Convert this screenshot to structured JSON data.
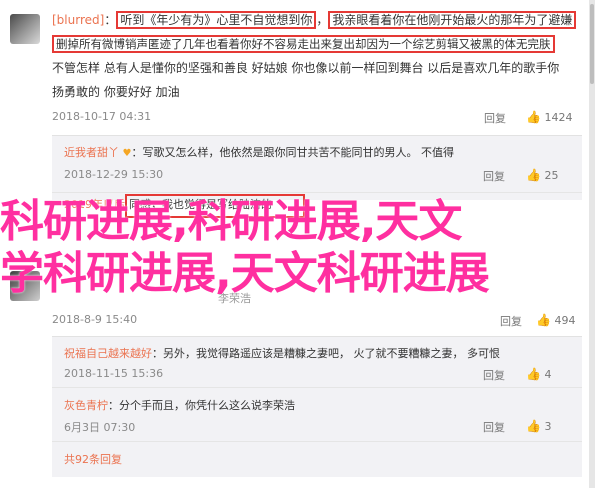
{
  "main_comment": {
    "username": "[blurred]",
    "line1_prefix": "：",
    "line1_highlight": "听到《年少有为》心里不自觉想到你",
    "line1_suffix": "，",
    "line1_highlight2": "我亲眼看着你在他刚开始最火的那年为了避嫌",
    "line2_highlight": "删掉所有微博销声匿迹了几年也看着你好不容易走出来复出却因为一个综艺剪辑又被黑的体无完肤",
    "line3": "不管怎样 总有人是懂你的坚强和善良 好姑娘 你也像以前一样回到舞台 以后是喜欢几年的歌手你",
    "line4": "扬勇敢的 你要好好 加油",
    "date": "2018-10-17 04:31",
    "reply_label": "回复",
    "like_icon": "thumbs-up-icon",
    "like_count": "1424"
  },
  "replies_top": [
    {
      "name": "近我者甜丫",
      "text": "：写歌又怎么样，他依然是跟你同甘共苦不能同甘的男人。  不值得",
      "date": "2018-12-29 15:30",
      "reply_label": "回复",
      "likes": "25"
    },
    {
      "name": "2019年以后",
      "text_highlight": "同感，我也觉得是写给陆涛的",
      "date": "",
      "reply_label": "",
      "likes": ""
    }
  ],
  "overlay": {
    "line1": "科研进展,科研进展,天文",
    "line2": "学科研进展,天文科研进展"
  },
  "second_comment": {
    "date": "2018-8-9 15:40",
    "reply_label": "回复",
    "likes": "494",
    "partial_text": "李荣浩"
  },
  "replies_bottom": [
    {
      "name": "祝福自己越来越好",
      "text": "：另外，我觉得路遥应该是糟糠之妻吧，  火了就不要糟糠之妻，  多可恨",
      "date": "2018-11-15 15:36",
      "reply_label": "回复",
      "likes": "4"
    },
    {
      "name": "灰色青柠",
      "text": "：分个手而且，你凭什么这么说李荣浩",
      "date": "6月3日 07:30",
      "reply_label": "回复",
      "likes": "3"
    }
  ],
  "more_replies": "共92条回复"
}
